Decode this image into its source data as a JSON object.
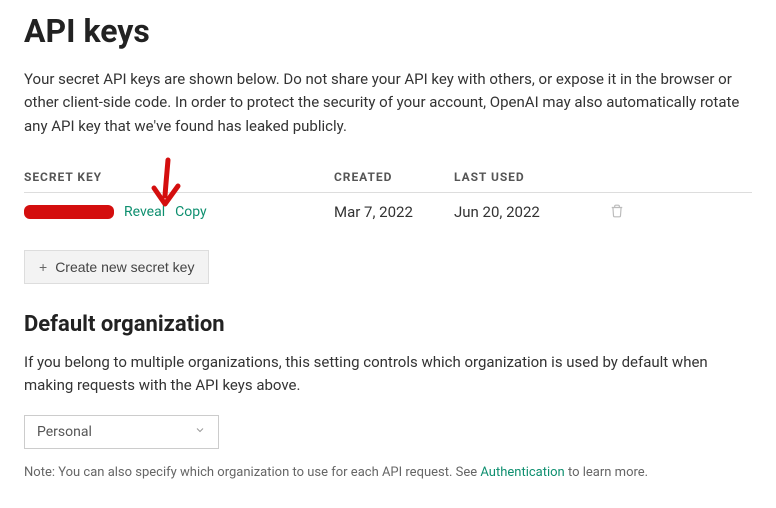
{
  "page": {
    "title": "API keys",
    "description": "Your secret API keys are shown below. Do not share your API key with others, or expose it in the browser or other client-side code. In order to protect the security of your account, OpenAI may also automatically rotate any API key that we've found has leaked publicly."
  },
  "table": {
    "headers": {
      "secret": "SECRET KEY",
      "created": "CREATED",
      "lastused": "LAST USED"
    },
    "row": {
      "reveal": "Reveal",
      "copy": "Copy",
      "created": "Mar 7, 2022",
      "lastused": "Jun 20, 2022"
    }
  },
  "buttons": {
    "create": "Create new secret key"
  },
  "org": {
    "heading": "Default organization",
    "description": "If you belong to multiple organizations, this setting controls which organization is used by default when making requests with the API keys above.",
    "selected": "Personal"
  },
  "note": {
    "prefix": "Note: You can also specify which organization to use for each API request. See ",
    "link": "Authentication",
    "suffix": " to learn more."
  }
}
